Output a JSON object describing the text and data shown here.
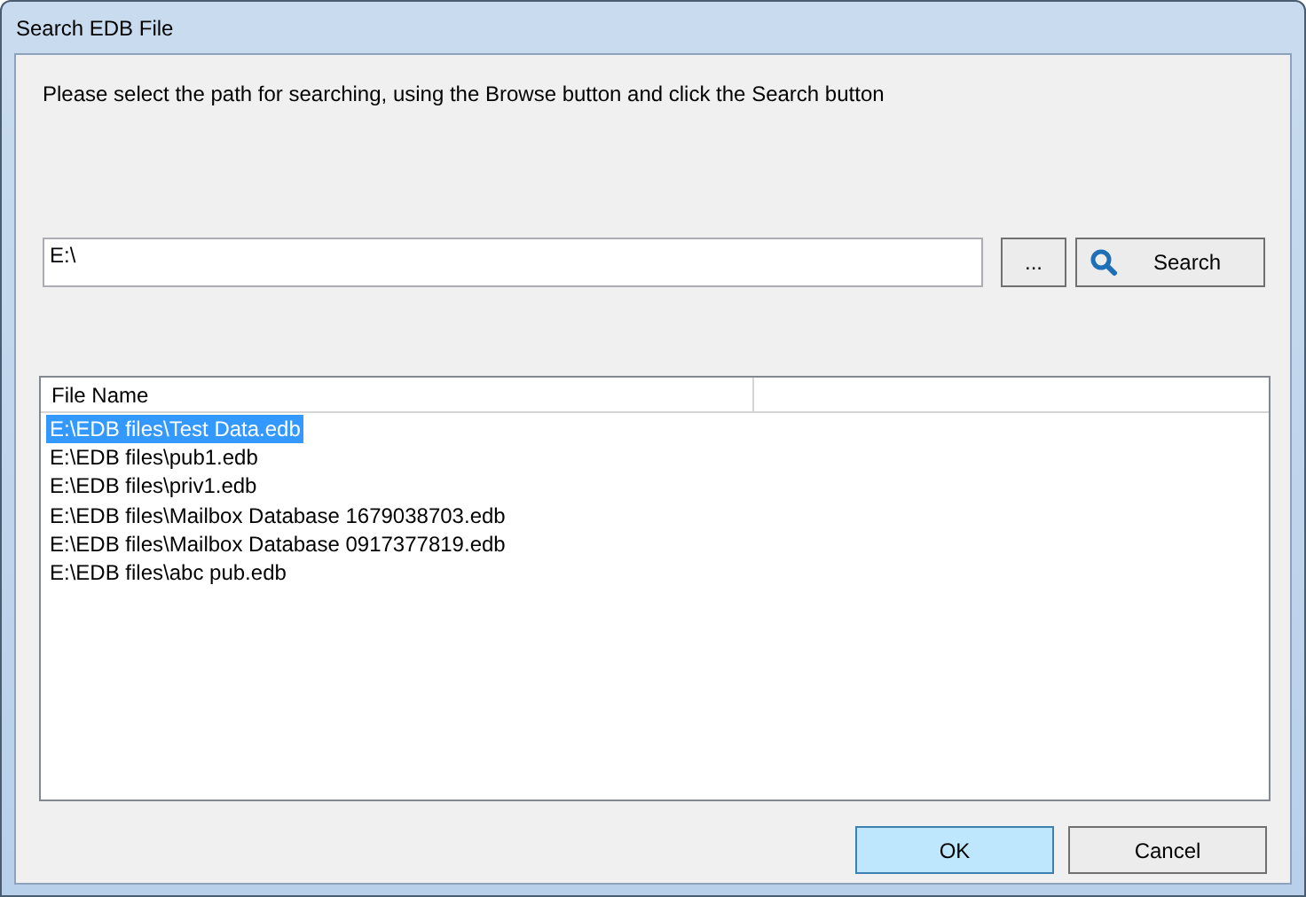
{
  "window": {
    "title": "Search EDB File"
  },
  "instruction": "Please select the path for searching, using the Browse button and click the Search button",
  "path_field": {
    "value": "E:\\"
  },
  "browse_button": "...",
  "search_button": "Search",
  "table": {
    "columns": [
      "File Name"
    ],
    "rows": [
      {
        "file_name": "E:\\EDB files\\Test Data.edb",
        "selected": true
      },
      {
        "file_name": "E:\\EDB files\\pub1.edb",
        "selected": false
      },
      {
        "file_name": "E:\\EDB files\\priv1.edb",
        "selected": false
      },
      {
        "file_name": "E:\\EDB files\\Mailbox Database 1679038703.edb",
        "selected": false
      },
      {
        "file_name": "E:\\EDB files\\Mailbox Database 0917377819.edb",
        "selected": false
      },
      {
        "file_name": "E:\\EDB files\\abc pub.edb",
        "selected": false
      }
    ]
  },
  "buttons": [
    {
      "label": "OK",
      "kind": "default"
    },
    {
      "label": "Cancel",
      "kind": "normal"
    }
  ]
}
